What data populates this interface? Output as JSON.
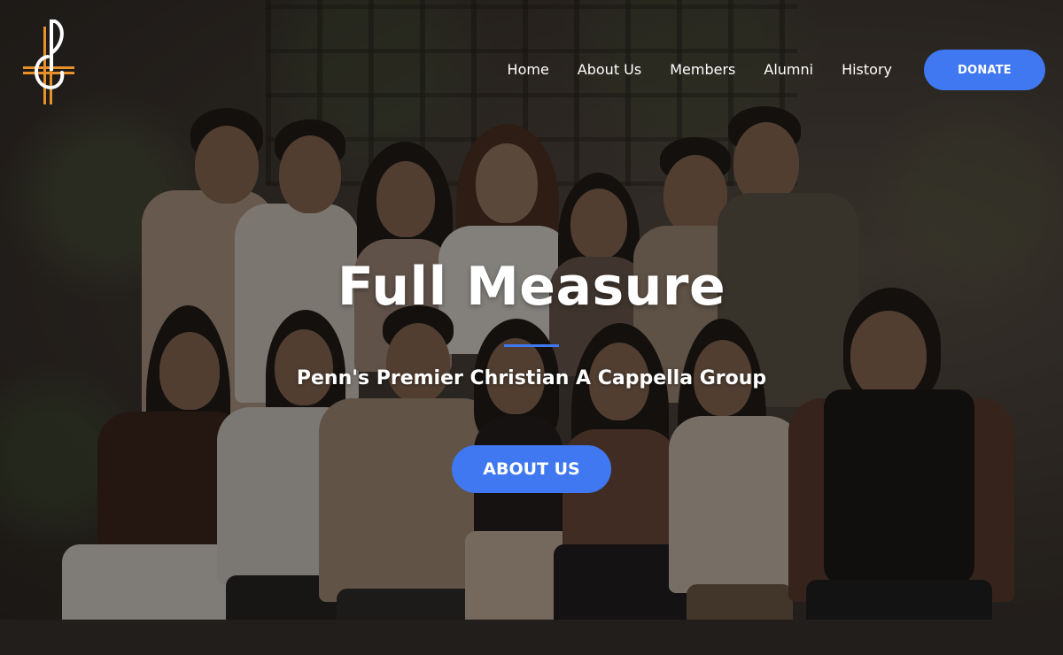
{
  "brand": {
    "logo_icon": "treble-clef-cross-icon",
    "logo_colors": {
      "stroke": "#ffffff",
      "accent": "#e8902a"
    }
  },
  "nav": {
    "items": [
      {
        "label": "Home"
      },
      {
        "label": "About Us"
      },
      {
        "label": "Members"
      },
      {
        "label": "Alumni"
      },
      {
        "label": "History"
      }
    ],
    "donate_label": "DONATE"
  },
  "hero": {
    "title": "Full Measure",
    "subtitle": "Penn's Premier Christian A Cappella Group",
    "cta_label": "ABOUT US",
    "background": "group-photo"
  },
  "colors": {
    "accent": "#3f78f0",
    "text": "#ffffff"
  }
}
